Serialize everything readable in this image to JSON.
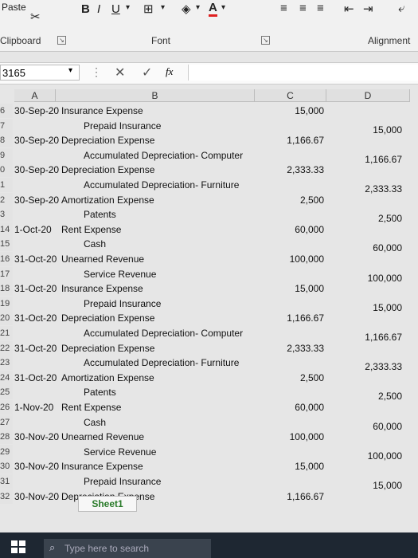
{
  "ribbon": {
    "paste_label": "Paste",
    "clipboard_label": "Clipboard",
    "font_label": "Font",
    "alignment_label": "Alignment",
    "bold": "B",
    "italic": "I",
    "underline": "U"
  },
  "formula_bar": {
    "name_box": "3165",
    "fx": "fx",
    "formula": ""
  },
  "columns": [
    "A",
    "B",
    "C",
    "D"
  ],
  "rows": [
    {
      "rn": "6",
      "date": "30-Sep-20",
      "acct": "Insurance Expense",
      "indent": false,
      "debit": "15,000",
      "credit": ""
    },
    {
      "rn": "7",
      "date": "",
      "acct": "Prepaid Insurance",
      "indent": true,
      "debit": "",
      "credit": "15,000"
    },
    {
      "rn": "8",
      "date": "30-Sep-20",
      "acct": "Depreciation Expense",
      "indent": false,
      "debit": "1,166.67",
      "credit": ""
    },
    {
      "rn": "9",
      "date": "",
      "acct": "Accumulated Depreciation- Computer",
      "indent": true,
      "debit": "",
      "credit": "1,166.67"
    },
    {
      "rn": "0",
      "date": "30-Sep-20",
      "acct": "Depreciation Expense",
      "indent": false,
      "debit": "2,333.33",
      "credit": ""
    },
    {
      "rn": "1",
      "date": "",
      "acct": "Accumulated Depreciation- Furniture",
      "indent": true,
      "debit": "",
      "credit": "2,333.33"
    },
    {
      "rn": "2",
      "date": "30-Sep-20",
      "acct": "Amortization Expense",
      "indent": false,
      "debit": "2,500",
      "credit": ""
    },
    {
      "rn": "3",
      "date": "",
      "acct": "Patents",
      "indent": true,
      "debit": "",
      "credit": "2,500"
    },
    {
      "rn": "14",
      "date": "1-Oct-20",
      "acct": "Rent Expense",
      "indent": false,
      "debit": "60,000",
      "credit": ""
    },
    {
      "rn": "15",
      "date": "",
      "acct": "Cash",
      "indent": true,
      "debit": "",
      "credit": "60,000"
    },
    {
      "rn": "16",
      "date": "31-Oct-20",
      "acct": "Unearned Revenue",
      "indent": false,
      "debit": "100,000",
      "credit": ""
    },
    {
      "rn": "17",
      "date": "",
      "acct": "Service Revenue",
      "indent": true,
      "debit": "",
      "credit": "100,000"
    },
    {
      "rn": "18",
      "date": "31-Oct-20",
      "acct": "Insurance Expense",
      "indent": false,
      "debit": "15,000",
      "credit": ""
    },
    {
      "rn": "19",
      "date": "",
      "acct": "Prepaid Insurance",
      "indent": true,
      "debit": "",
      "credit": "15,000"
    },
    {
      "rn": "20",
      "date": "31-Oct-20",
      "acct": "Depreciation Expense",
      "indent": false,
      "debit": "1,166.67",
      "credit": ""
    },
    {
      "rn": "21",
      "date": "",
      "acct": "Accumulated Depreciation- Computer",
      "indent": true,
      "debit": "",
      "credit": "1,166.67"
    },
    {
      "rn": "22",
      "date": "31-Oct-20",
      "acct": "Depreciation Expense",
      "indent": false,
      "debit": "2,333.33",
      "credit": ""
    },
    {
      "rn": "23",
      "date": "",
      "acct": "Accumulated Depreciation- Furniture",
      "indent": true,
      "debit": "",
      "credit": "2,333.33"
    },
    {
      "rn": "24",
      "date": "31-Oct-20",
      "acct": "Amortization Expense",
      "indent": false,
      "debit": "2,500",
      "credit": ""
    },
    {
      "rn": "25",
      "date": "",
      "acct": "Patents",
      "indent": true,
      "debit": "",
      "credit": "2,500"
    },
    {
      "rn": "26",
      "date": "1-Nov-20",
      "acct": "Rent Expense",
      "indent": false,
      "debit": "60,000",
      "credit": ""
    },
    {
      "rn": "27",
      "date": "",
      "acct": "Cash",
      "indent": true,
      "debit": "",
      "credit": "60,000"
    },
    {
      "rn": "28",
      "date": "30-Nov-20",
      "acct": "Unearned Revenue",
      "indent": false,
      "debit": "100,000",
      "credit": ""
    },
    {
      "rn": "29",
      "date": "",
      "acct": "Service Revenue",
      "indent": true,
      "debit": "",
      "credit": "100,000"
    },
    {
      "rn": "30",
      "date": "30-Nov-20",
      "acct": "Insurance Expense",
      "indent": false,
      "debit": "15,000",
      "credit": ""
    },
    {
      "rn": "31",
      "date": "",
      "acct": "Prepaid Insurance",
      "indent": true,
      "debit": "",
      "credit": "15,000"
    },
    {
      "rn": "32",
      "date": "30-Nov-20",
      "acct": "Depreciation Expense",
      "indent": false,
      "debit": "1,166.67",
      "credit": ""
    }
  ],
  "sheet_tab": "Sheet1",
  "taskbar": {
    "search_placeholder": "Type here to search"
  },
  "colors": {
    "ribbon_bg": "#f1f1f1",
    "sheet_tab_text": "#2a7b2a",
    "taskbar_bg": "#1e2732"
  }
}
